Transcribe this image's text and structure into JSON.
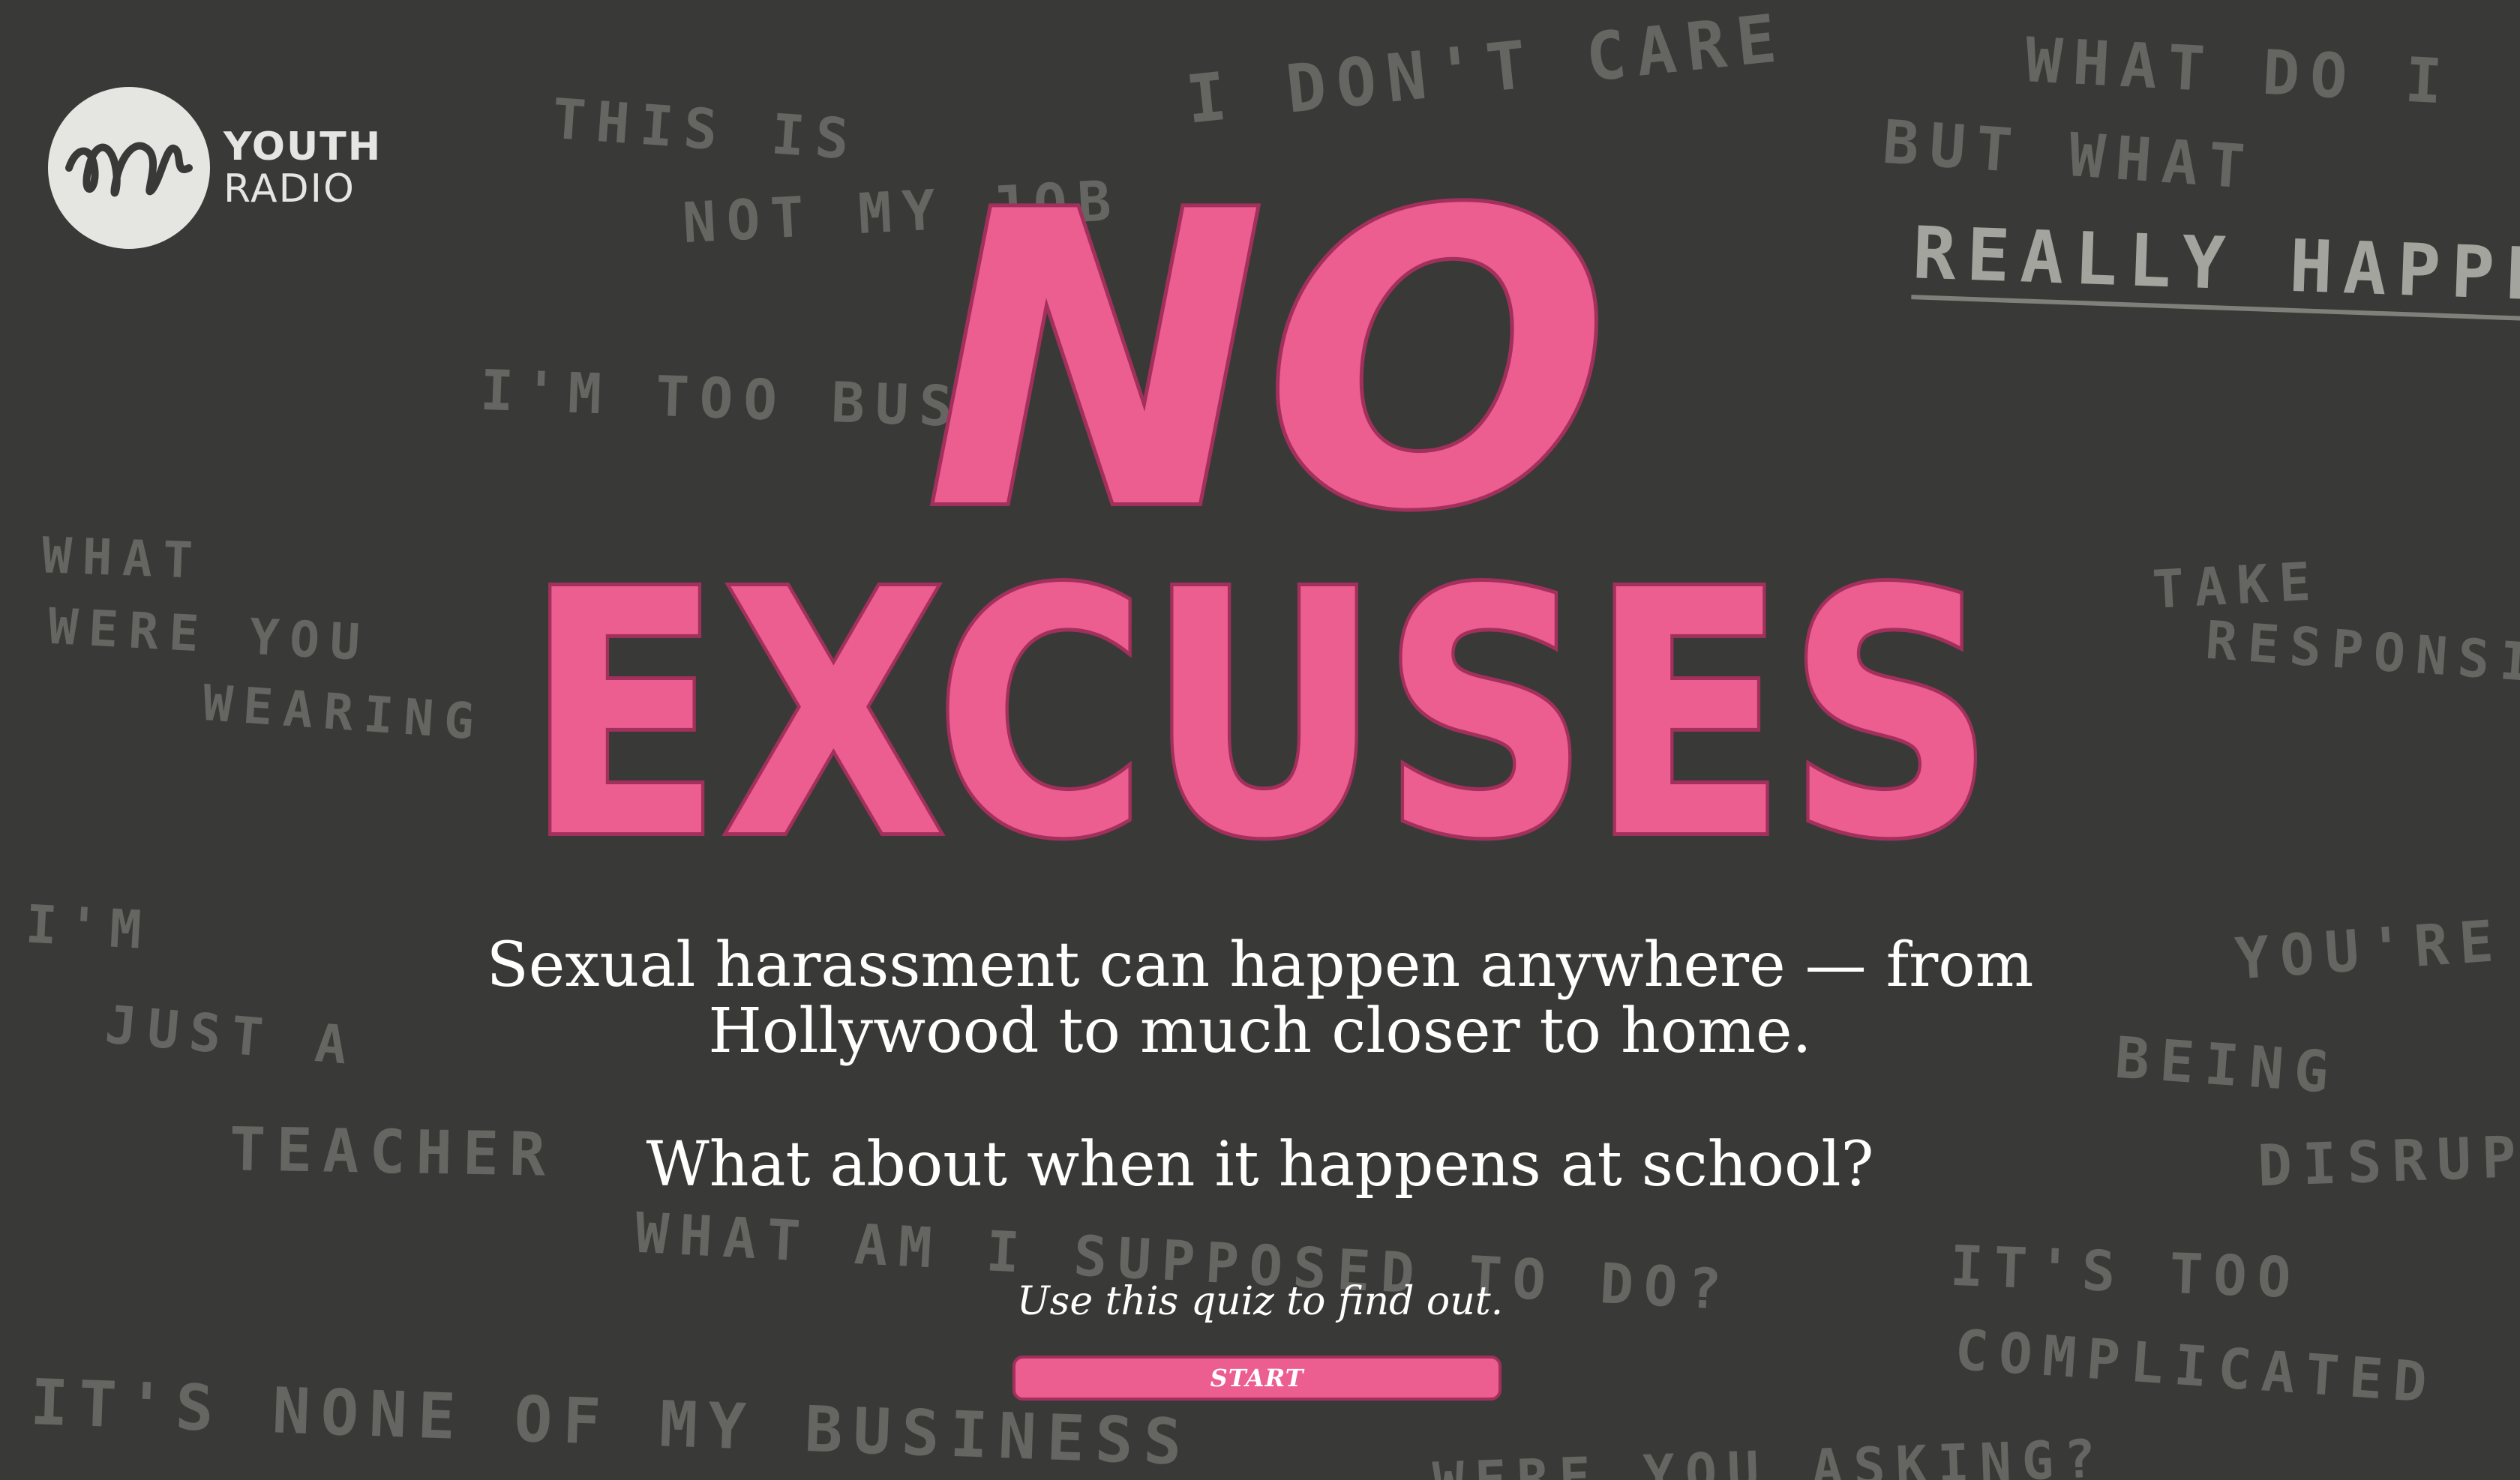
{
  "brand": {
    "logo_line1": "YOUTH",
    "logo_line2": "RADIO"
  },
  "hero": {
    "line1": "NO",
    "line2": "EXCUSES"
  },
  "background_phrases": [
    "I DON'T CARE",
    "THIS IS",
    "NOT MY JOB",
    "WHAT DO I",
    "BUT WHAT",
    "REALLY HAPPENED",
    "I'M TOO BUSY",
    "WHAT",
    "WERE YOU",
    "WEARING",
    "TAKE",
    "RESPONSIBILITY",
    "I'M",
    "JUST A",
    "TEACHER",
    "YOU'RE",
    "BEING",
    "DISRUPTIVE",
    "WHAT AM I SUPPOSED TO DO?",
    "IT'S TOO",
    "COMPLICATED",
    "IT'S NONE OF MY BUSINESS",
    "WERE YOU ASKING?"
  ],
  "intro": {
    "paragraph1_line1": "Sexual harassment can happen anywhere — from",
    "paragraph1_line2": "Hollywood to much closer to home.",
    "question": "What about when it happens at school?",
    "cta_text": "Use this quiz to find out."
  },
  "buttons": {
    "start_label": "START"
  },
  "colors": {
    "background": "#393a37",
    "accent_pink": "#ec5d90",
    "accent_outline": "#a3305c",
    "chalk": "#6d6e69",
    "text": "#ffffff"
  }
}
